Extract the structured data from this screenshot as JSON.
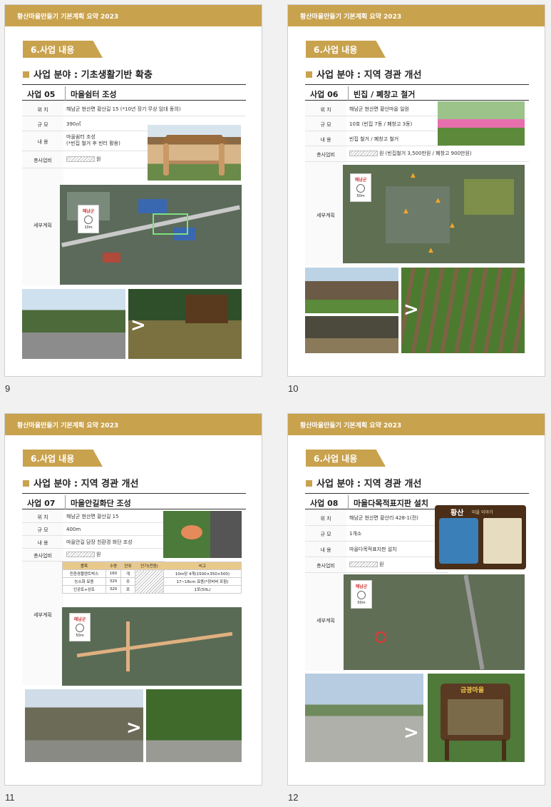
{
  "header_text": "황산마을만들기 기본계획 요약  2023",
  "section_label": "6.사업 내용",
  "labels": {
    "location": "위   치",
    "scale": "규  모",
    "content": "내   용",
    "budget": "총사업비",
    "plan": "세부계획",
    "won": "원"
  },
  "pages": [
    {
      "number": "9",
      "field": "사업 분야 : 기초생활기반 확충",
      "project_id": "사업 05",
      "project_name": "마을쉼터 조성",
      "location": "해남군 현산면 황산길 15 (*10년 장기 무상 임대 동의)",
      "scale": "390㎡",
      "content": "마을쉼터 조성\n(*빈집 철거 후 빈터 활용)",
      "budget_note": ""
    },
    {
      "number": "10",
      "field": "사업 분야 : 지역 경관 개선",
      "project_id": "사업 06",
      "project_name": "빈집 / 폐창고 철거",
      "location": "해남군 현산면 황산마을 일원",
      "scale": "10호 (빈집 7동 / 폐창고 3동)",
      "content": "빈집 철거  / 폐창고 철거",
      "budget_note": "(빈집철거 3,500만원 / 폐창고 900만원)"
    },
    {
      "number": "11",
      "field": "사업 분야 : 지역 경관 개선",
      "project_id": "사업 07",
      "project_name": "마을안길화단 조성",
      "location": "해남군 현산면 황산길 15",
      "scale": "400m",
      "content": "마을안길 담장 친환경 화단 조성",
      "budget_note": "",
      "table": {
        "headers": [
          "품목",
          "수량",
          "단위",
          "단가(천원)",
          "비고"
        ],
        "rows": [
          [
            "친환경플랜트박스",
            "160",
            "개",
            "",
            "10m당 4개(1500×350×500)"
          ],
          [
            "능소화 묘종",
            "320",
            "주",
            "",
            "17~18cm 묘종(*장비비 포함)"
          ],
          [
            "인공토+상토",
            "320",
            "포",
            "",
            "1포(50L)"
          ]
        ]
      }
    },
    {
      "number": "12",
      "field": "사업 분야 : 지역 경관 개선",
      "project_id": "사업 08",
      "project_name": "마을다목적표지판 설치",
      "location": "해남군 현산면 황산리 428-1(전)",
      "scale": "1개소",
      "content": "마을다목적표지판 설치",
      "budget_note": "",
      "sign_title": "황산",
      "sign_subtitle": "마을 이야기",
      "sign2_title": "금광마을"
    }
  ],
  "map": {
    "logo": "해남군",
    "scale_10": "10m",
    "scale_50": "50m"
  },
  "colors": {
    "accent": "#c9a24e",
    "header_bg": "#c9a24e"
  }
}
